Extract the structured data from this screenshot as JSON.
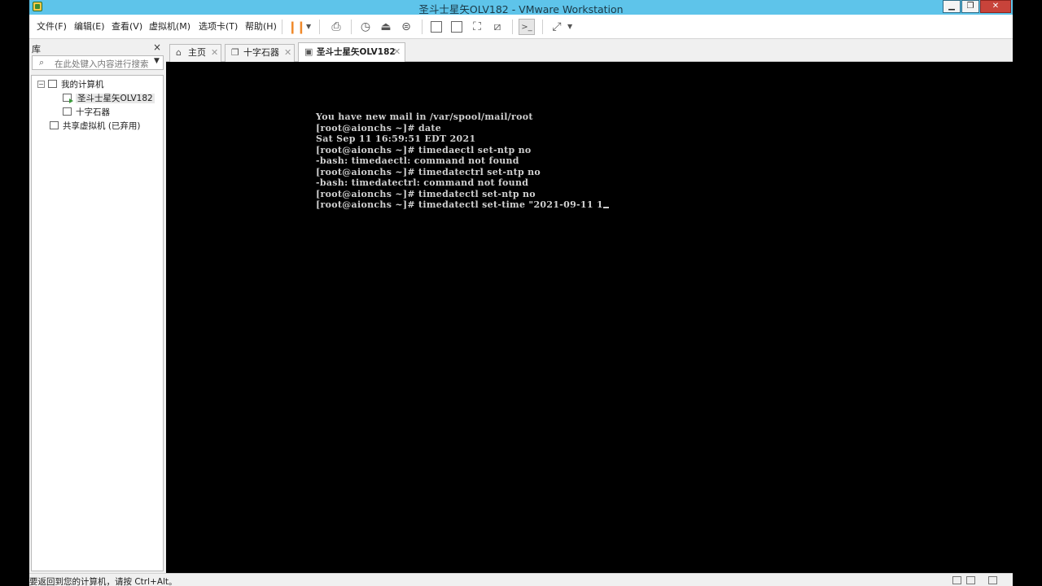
{
  "window": {
    "title": "圣斗士星矢OLV182 - VMware Workstation"
  },
  "menu": {
    "items": [
      "文件(F)",
      "编辑(E)",
      "查看(V)",
      "虚拟机(M)",
      "选项卡(T)",
      "帮助(H)"
    ]
  },
  "toolbar": {
    "icons": [
      "pause-icon",
      "send-keys-icon",
      "snapshot-icon",
      "revert-snapshot-icon",
      "snapshot-manager-icon",
      "library-view-icon",
      "thumbnail-view-icon",
      "fullscreen-icon",
      "unity-icon",
      "console-view-icon",
      "stretch-icon"
    ]
  },
  "library": {
    "title": "库",
    "close_glyph": "×",
    "search_placeholder": "在此处键入内容进行搜索",
    "tree": {
      "root": "我的计算机",
      "vms": [
        "圣斗士星矢OLV182",
        "十字石器"
      ],
      "shared": "共享虚拟机 (已弃用)"
    }
  },
  "tabs": [
    {
      "label": "主页",
      "icon": "home-icon",
      "active": false
    },
    {
      "label": "十字石器",
      "icon": "vm-icon",
      "active": false
    },
    {
      "label": "圣斗士星矢OLV182",
      "icon": "vm-running-icon",
      "active": true
    }
  ],
  "console": {
    "lines": [
      "You have new mail in /var/spool/mail/root",
      "[root@aionchs ~]# date",
      "Sat Sep 11 16:59:51 EDT 2021",
      "[root@aionchs ~]# timedaectl set-ntp no",
      "-bash: timedaectl: command not found",
      "[root@aionchs ~]# timedatectrl set-ntp no",
      "-bash: timedatectrl: command not found",
      "[root@aionchs ~]# timedatectl set-ntp no",
      "[root@aionchs ~]# timedatectl set-time \"2021-09-11 1"
    ]
  },
  "status": {
    "text": "要返回到您的计算机，请按 Ctrl+Alt。"
  },
  "colors": {
    "titlebar": "#5ec4ea",
    "close": "#c8433a",
    "accent_pause": "#f0892a"
  }
}
